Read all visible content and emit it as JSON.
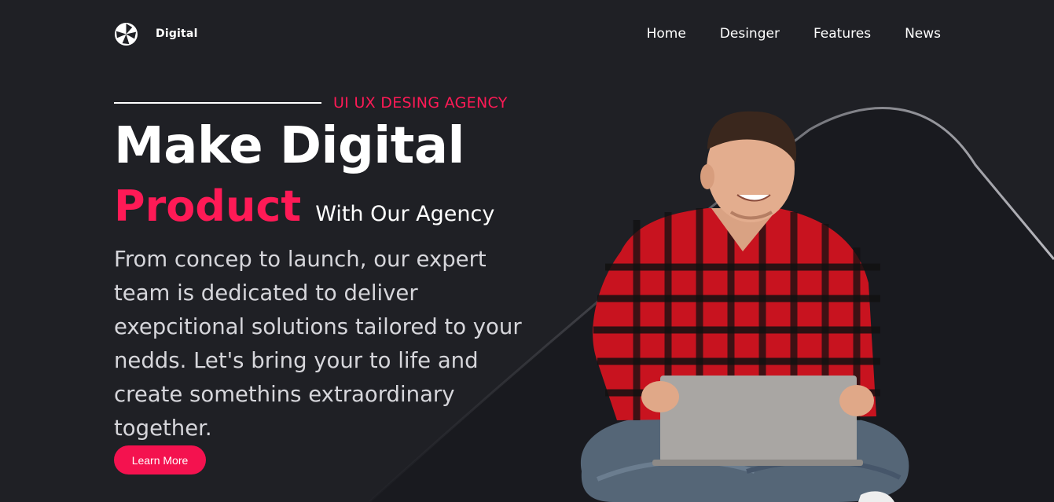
{
  "brand": {
    "name": "Digital",
    "icon": "aperture-logo-icon"
  },
  "nav": {
    "items": [
      {
        "label": "Home"
      },
      {
        "label": "Desinger"
      },
      {
        "label": "Features"
      },
      {
        "label": "News"
      }
    ]
  },
  "hero": {
    "eyebrow": "UI UX DESING AGENCY",
    "headline_line1": "Make Digital",
    "headline_accent": "Product",
    "headline_tail": "With Our Agency",
    "body": "From concep to launch, our expert team is dedicated to deliver exepcitional solutions tailored to your nedds. Let's bring your to life and create somethins extraordinary together.",
    "cta_label": "Learn More",
    "image": "person-in-plaid-shirt-with-laptop"
  },
  "colors": {
    "background": "#1f2025",
    "accent": "#ff1a56",
    "text": "#ffffff",
    "muted_text": "#d6d6db"
  }
}
